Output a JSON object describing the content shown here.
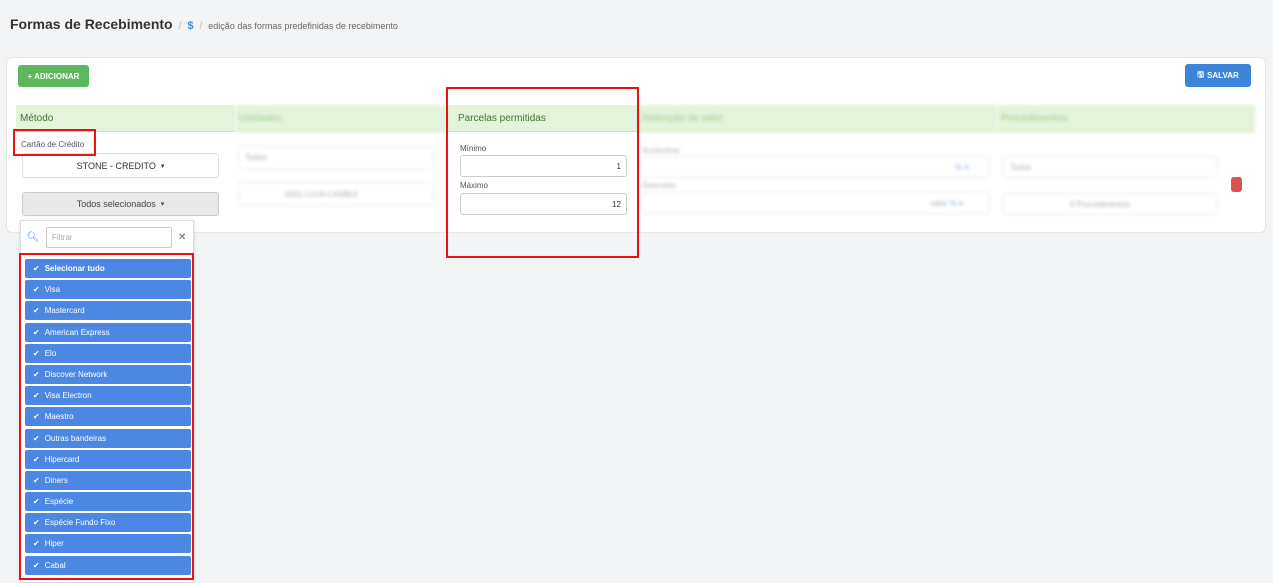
{
  "header": {
    "title": "Formas de Recebimento",
    "separator": "/",
    "currency_icon": "$",
    "separator2": "/",
    "description": "edição das formas predefinidas de recebimento"
  },
  "toolbar": {
    "add_label": "+ ADICIONAR",
    "save_icon": "floppy-icon",
    "save_label": "SALVAR"
  },
  "columns": {
    "metodo": "Método",
    "parcelas": "Parcelas permitidas"
  },
  "metodo": {
    "label": "Cartão de Crédito",
    "acquirer": "STONE - CREDITO",
    "acquirer_caret": "▾",
    "selected_flags": "Todos selecionados",
    "selected_caret": "▾"
  },
  "parcelas": {
    "min_label": "Mínimo",
    "min_value": "1",
    "max_label": "Máximo",
    "max_value": "12"
  },
  "flag_dropdown": {
    "filter_placeholder": "Filtrar",
    "items": [
      "Selecionar tudo",
      "Visa",
      "Mastercard",
      "American Express",
      "Elo",
      "Discover Network",
      "Visa Electron",
      "Maestro",
      "Outras bandeiras",
      "Hipercard",
      "Diners",
      "Espécie",
      "Espécie Fundo Fixo",
      "Hiper",
      "Cabal"
    ]
  },
  "colors": {
    "accent": "#3d85d8",
    "add_button": "#5cb85c",
    "column_header_bg": "#e4f3dc",
    "selected_item_bg": "#4b87e3",
    "highlight": "#ee1111"
  }
}
